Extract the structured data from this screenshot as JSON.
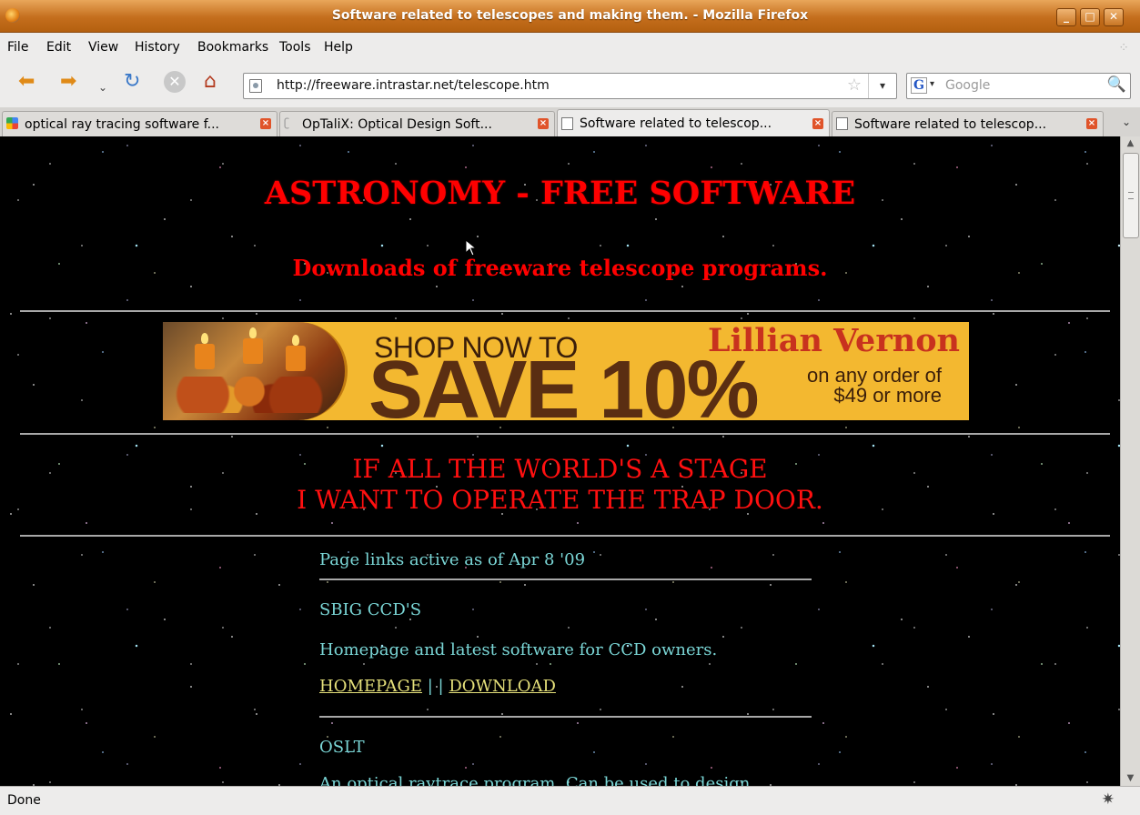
{
  "window": {
    "title": "Software related to telescopes and making them. - Mozilla Firefox",
    "buttons": {
      "minimize": "_",
      "maximize": "□",
      "close": "✕"
    }
  },
  "menubar": {
    "items": [
      "File",
      "Edit",
      "View",
      "History",
      "Bookmarks",
      "Tools",
      "Help"
    ]
  },
  "navbar": {
    "back_icon": "back-arrow-icon",
    "forward_icon": "forward-arrow-icon",
    "url": "http://freeware.intrastar.net/telescope.htm",
    "search_placeholder": "Google"
  },
  "tabs": [
    {
      "label": "optical ray tracing software f...",
      "active": false
    },
    {
      "label": "OpTaliX: Optical Design Soft...",
      "active": false
    },
    {
      "label": "Software related to telescop...",
      "active": true
    },
    {
      "label": "Software related to telescop...",
      "active": false
    }
  ],
  "page": {
    "heading": "ASTRONOMY - FREE SOFTWARE",
    "subheading": "Downloads of freeware telescope programs.",
    "ad": {
      "line1": "SHOP NOW TO",
      "brand": "Lillian Vernon",
      "save": "SAVE 10%",
      "terms_line1": "on any order of",
      "terms_line2": "$49 or more"
    },
    "quote_line1": "IF ALL THE WORLD'S A STAGE",
    "quote_line2": "I WANT TO OPERATE THE TRAP DOOR.",
    "links_active": "Page links active as of Apr 8 '09",
    "section1_title": "SBIG CCD'S",
    "section1_desc": "Homepage and latest software for CCD owners.",
    "homepage_link": "HOMEPAGE",
    "separator": "| |",
    "download_link": "DOWNLOAD",
    "section2_title": "OSLT",
    "section2_desc": "An optical raytrace program. Can be used to design"
  },
  "status": {
    "text": "Done"
  },
  "colors": {
    "titlebar": "#c46e1d",
    "heading": "#ff0000",
    "link_text": "#7ad6d6",
    "link_yellow": "#e5e07a",
    "ad_background": "#f3b830"
  }
}
